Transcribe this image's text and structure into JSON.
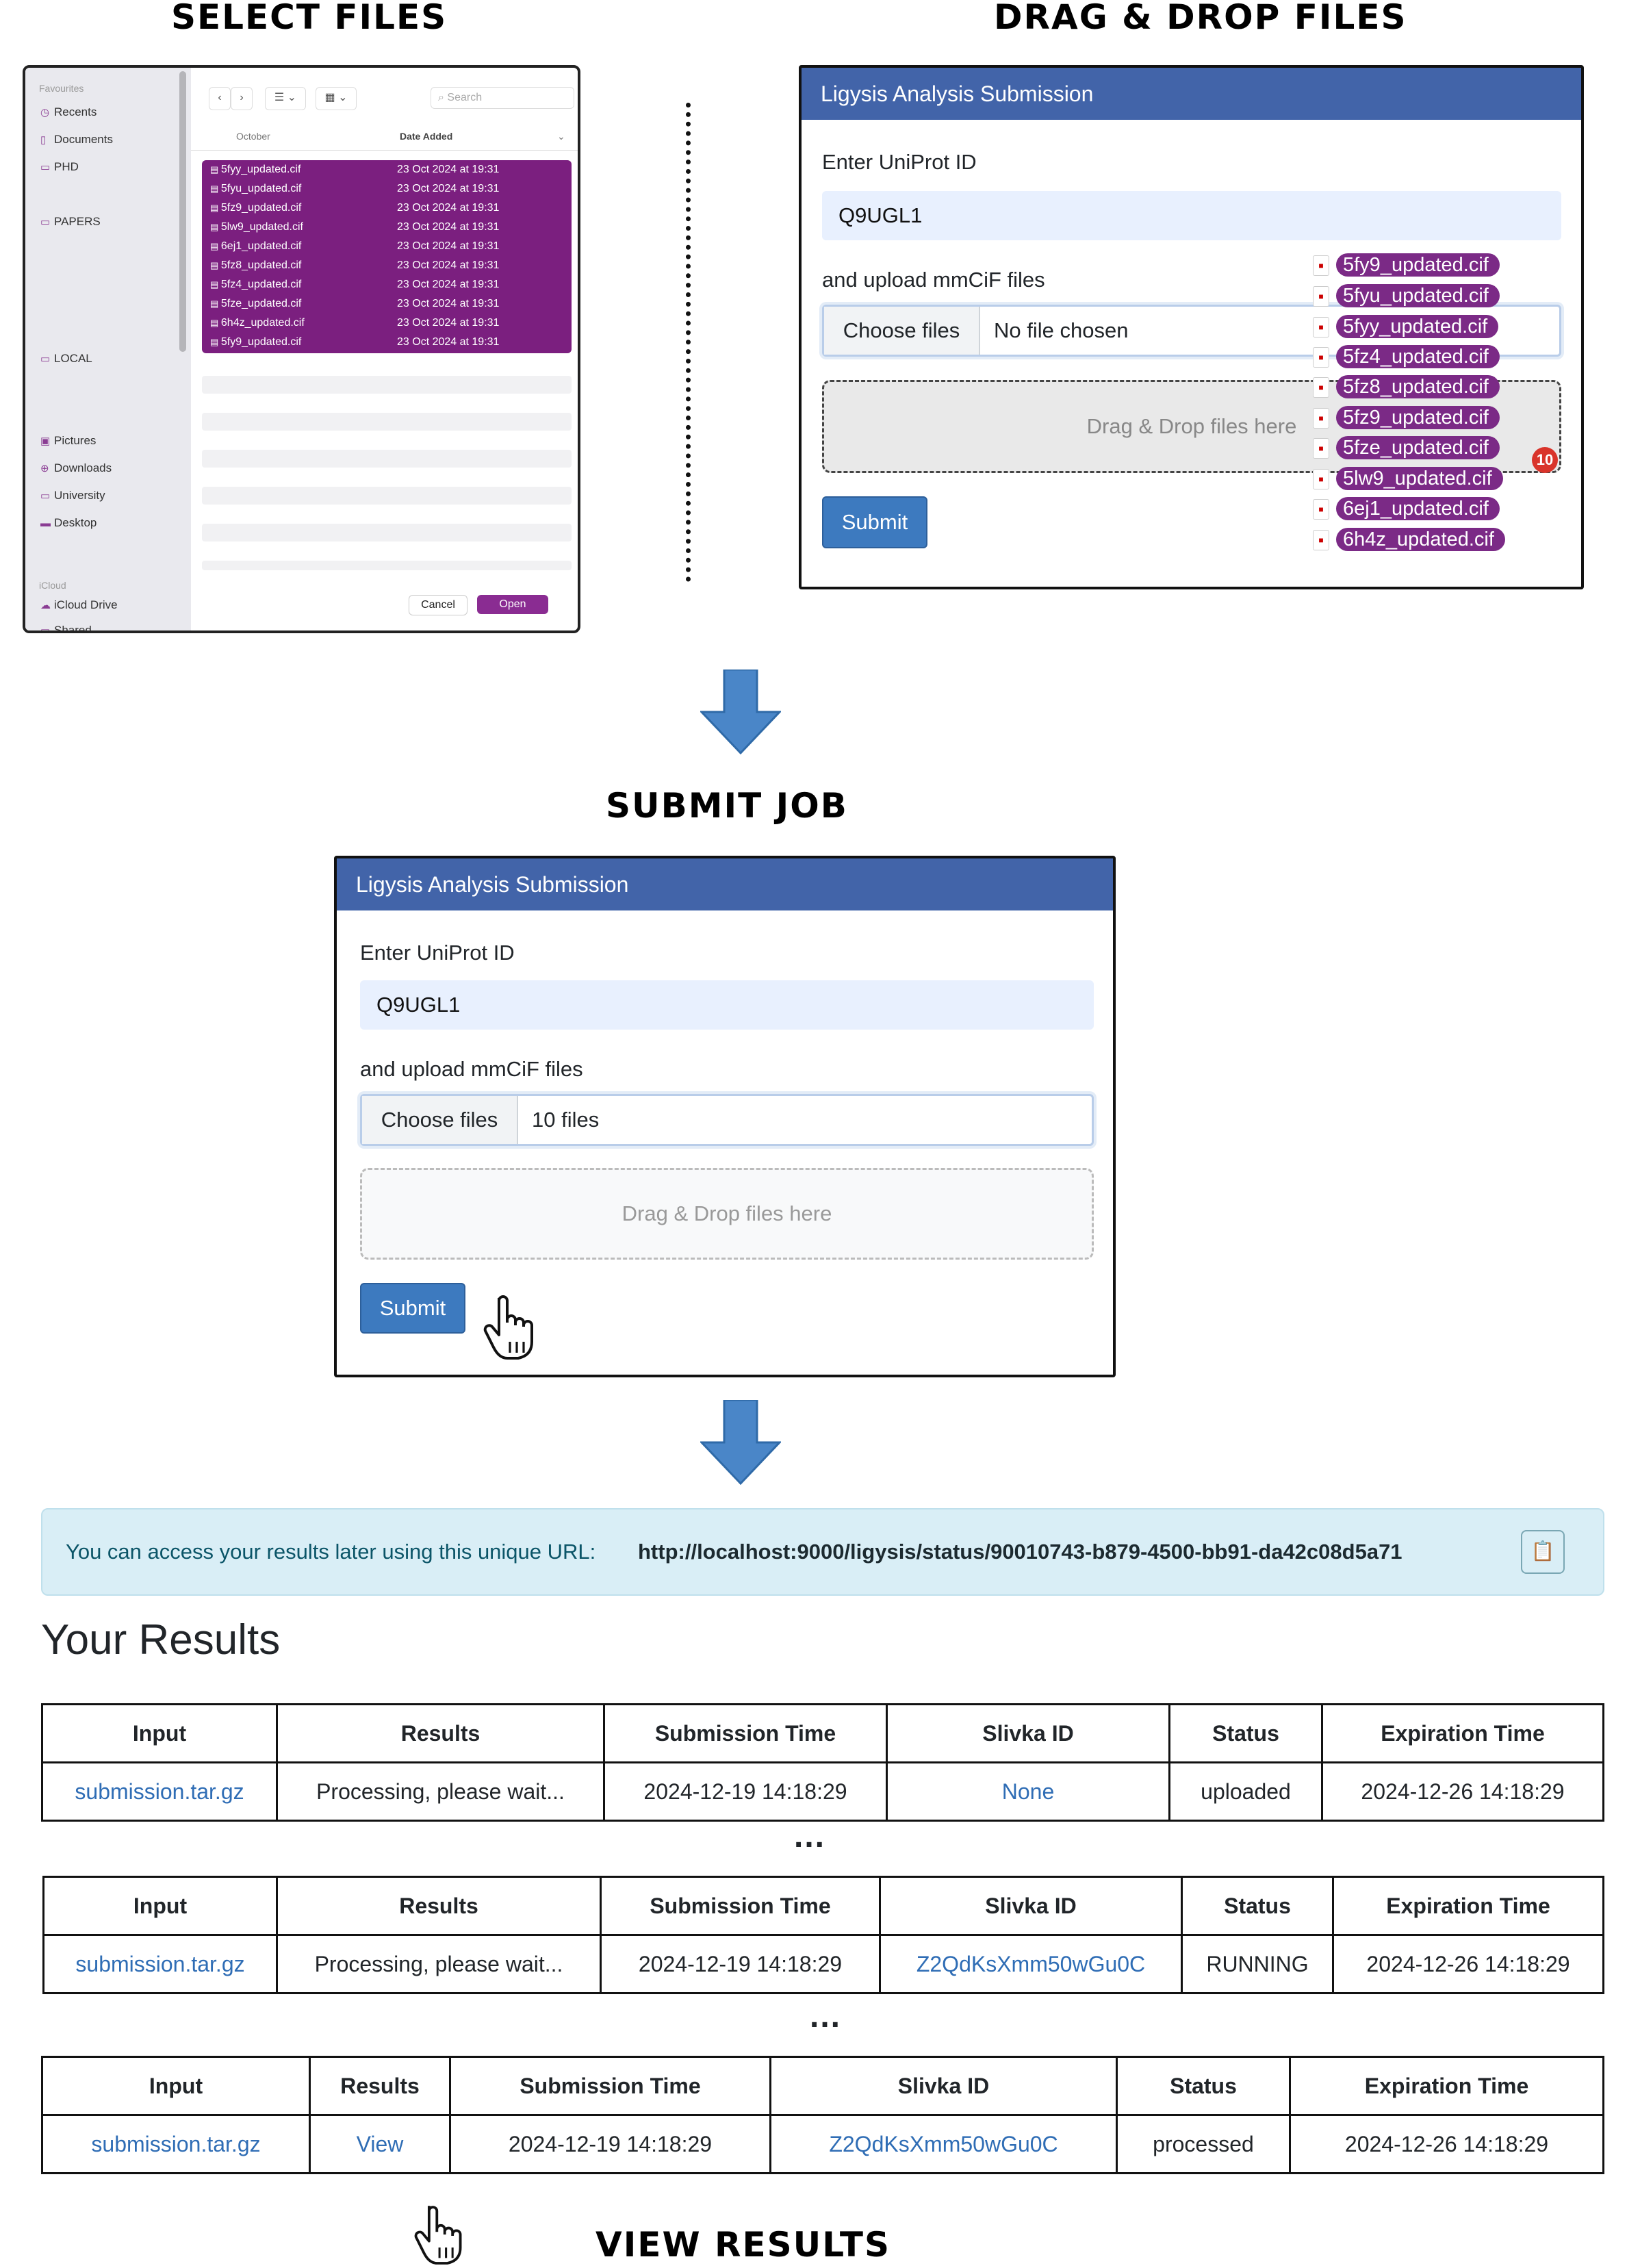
{
  "headings": {
    "select": "SELECT FILES",
    "drag": "DRAG & DROP FILES",
    "submit": "SUBMIT JOB",
    "view": "VIEW RESULTS"
  },
  "finder": {
    "sidebar": {
      "favourites": "Favourites",
      "items": [
        "Recents",
        "Documents",
        "PHD",
        "PAPERS",
        "LOCAL",
        "Pictures",
        "Downloads",
        "University",
        "Desktop"
      ],
      "icloud": "iCloud",
      "icloud_items": [
        "iCloud Drive",
        "Shared"
      ]
    },
    "search_placeholder": "Search",
    "col_name": "October",
    "col_date": "Date Added",
    "files": [
      {
        "name": "5fyy_updated.cif",
        "date": "23 Oct 2024 at 19:31"
      },
      {
        "name": "5fyu_updated.cif",
        "date": "23 Oct 2024 at 19:31"
      },
      {
        "name": "5fz9_updated.cif",
        "date": "23 Oct 2024 at 19:31"
      },
      {
        "name": "5lw9_updated.cif",
        "date": "23 Oct 2024 at 19:31"
      },
      {
        "name": "6ej1_updated.cif",
        "date": "23 Oct 2024 at 19:31"
      },
      {
        "name": "5fz8_updated.cif",
        "date": "23 Oct 2024 at 19:31"
      },
      {
        "name": "5fz4_updated.cif",
        "date": "23 Oct 2024 at 19:31"
      },
      {
        "name": "5fze_updated.cif",
        "date": "23 Oct 2024 at 19:31"
      },
      {
        "name": "6h4z_updated.cif",
        "date": "23 Oct 2024 at 19:31"
      },
      {
        "name": "5fy9_updated.cif",
        "date": "23 Oct 2024 at 19:31"
      }
    ],
    "cancel": "Cancel",
    "open": "Open"
  },
  "form1": {
    "title": "Ligysis Analysis Submission",
    "uniprot_label": "Enter UniProt ID",
    "uniprot_value": "Q9UGL1",
    "upload_label": "and upload mmCiF files",
    "choose": "Choose files",
    "file_status": "No file chosen",
    "drop_text": "Drag & Drop files here",
    "submit": "Submit",
    "dragged_files": [
      "5fy9_updated.cif",
      "5fyu_updated.cif",
      "5fyy_updated.cif",
      "5fz4_updated.cif",
      "5fz8_updated.cif",
      "5fz9_updated.cif",
      "5fze_updated.cif",
      "5lw9_updated.cif",
      "6ej1_updated.cif",
      "6h4z_updated.cif"
    ],
    "badge": "10"
  },
  "form2": {
    "title": "Ligysis Analysis Submission",
    "uniprot_label": "Enter UniProt ID",
    "uniprot_value": "Q9UGL1",
    "upload_label": "and upload mmCiF files",
    "choose": "Choose files",
    "file_status": "10 files",
    "drop_text": "Drag & Drop files here",
    "submit": "Submit"
  },
  "alert": {
    "text": "You can access your results later using this unique URL:",
    "url": "http://localhost:9000/ligysis/status/90010743-b879-4500-bb91-da42c08d5a71"
  },
  "results_title": "Your Results",
  "columns": [
    "Input",
    "Results",
    "Submission Time",
    "Slivka ID",
    "Status",
    "Expiration Time"
  ],
  "rows": [
    {
      "input": "submission.tar.gz",
      "results": "Processing, please wait...",
      "submitted": "2024-12-19 14:18:29",
      "slivka": "None",
      "status": "uploaded",
      "expires": "2024-12-26 14:18:29"
    },
    {
      "input": "submission.tar.gz",
      "results": "Processing, please wait...",
      "submitted": "2024-12-19 14:18:29",
      "slivka": "Z2QdKsXmm50wGu0C",
      "status": "RUNNING",
      "expires": "2024-12-26 14:18:29"
    },
    {
      "input": "submission.tar.gz",
      "results": "View",
      "submitted": "2024-12-19 14:18:29",
      "slivka": "Z2QdKsXmm50wGu0C",
      "status": "processed",
      "expires": "2024-12-26 14:18:29"
    }
  ],
  "ellipsis": "...",
  "colors": {
    "header_blue": "#4264a9",
    "finder_select": "#7b1f7f",
    "link": "#2f6db5",
    "arrow": "#4a86c8"
  }
}
